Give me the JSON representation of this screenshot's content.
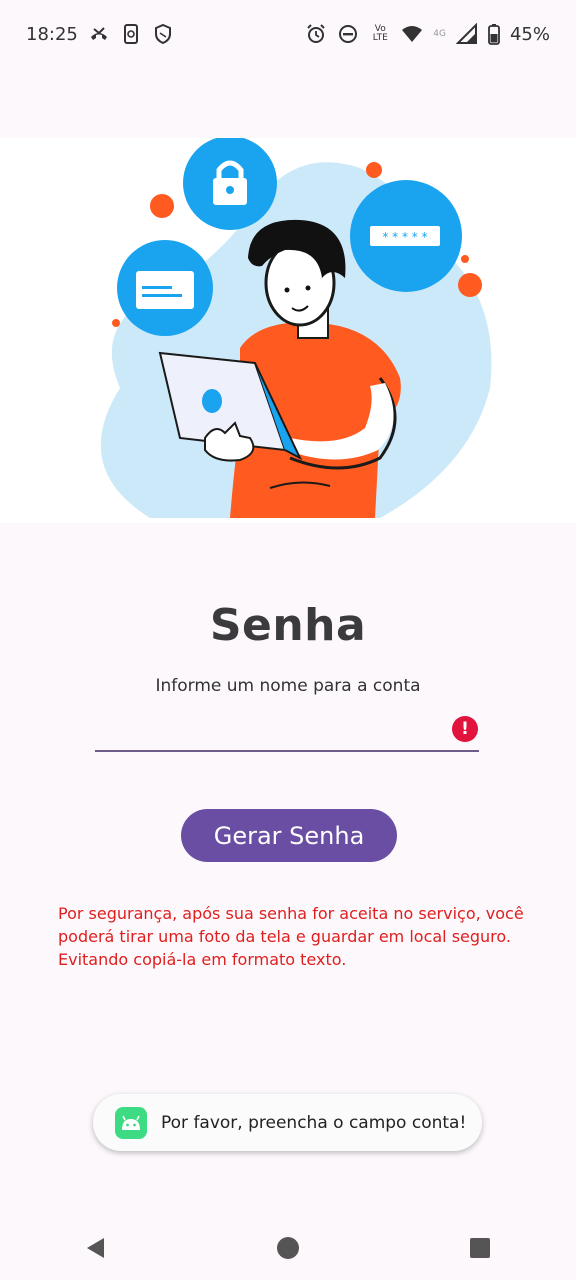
{
  "status_bar": {
    "time": "18:25",
    "lte_label": "Vo LTE",
    "network_label": "4G",
    "battery_percent": "45%"
  },
  "page": {
    "title": "Senha",
    "subtitle": "Informe um nome para a conta",
    "account_input_value": "",
    "account_input_placeholder": "",
    "generate_button_label": "Gerar Senha",
    "warning_text": "Por segurança, após sua senha for aceita no serviço, você poderá tirar uma foto da tela e guardar em local seguro. Evitando copiá-la em formato texto.",
    "error_icon_symbol": "!"
  },
  "toast": {
    "message": "Por favor, preencha o campo conta!"
  },
  "colors": {
    "accent": "#6a4ea3",
    "error": "#e0143c",
    "warning_text": "#e01e1e",
    "illustration_blue": "#1aa3ef",
    "illustration_orange": "#ff5a1f",
    "illustration_blob": "#cbe9f8"
  },
  "icons": {
    "nav_back": "back-triangle-icon",
    "nav_home": "home-circle-icon",
    "nav_recents": "recents-square-icon"
  }
}
